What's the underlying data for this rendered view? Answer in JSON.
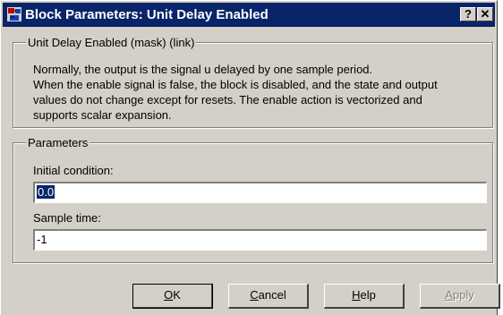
{
  "window": {
    "title": "Block Parameters: Unit Delay Enabled",
    "help_button": "?",
    "close_button": "✕"
  },
  "description_group": {
    "legend": "Unit Delay Enabled (mask) (link)",
    "lines": [
      "Normally, the output is the signal u delayed by one sample period.",
      "When the enable signal is false, the block is disabled, and the state and output",
      "values do not change except for resets.  The enable action is vectorized and",
      "supports scalar expansion."
    ]
  },
  "parameters_group": {
    "legend": "Parameters",
    "initial_condition_label": "Initial condition:",
    "initial_condition_value": "0.0",
    "sample_time_label": "Sample time:",
    "sample_time_value": "-1"
  },
  "buttons": {
    "ok_accel": "O",
    "ok_rest": "K",
    "cancel_accel": "C",
    "cancel_rest": "ancel",
    "help_accel": "H",
    "help_rest": "elp",
    "apply_accel": "A",
    "apply_rest": "pply"
  },
  "colors": {
    "titlebar": "#0a246a",
    "dialog_face": "#d4d0c8",
    "selection": "#0a246a"
  }
}
